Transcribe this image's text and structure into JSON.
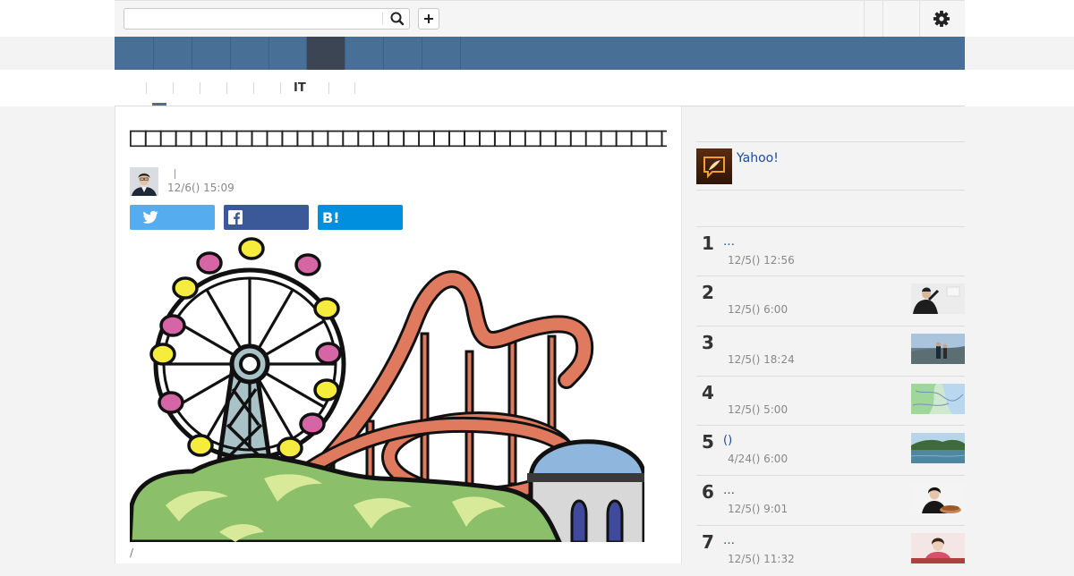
{
  "colors": {
    "nav_bar": "#486f96",
    "nav_active": "#3c4554",
    "link": "#1a4a9b",
    "twitter": "#55acee",
    "facebook": "#3b5998",
    "hatena": "#008fde"
  },
  "search": {
    "value": "",
    "placeholder": ""
  },
  "header": {
    "search_icon": "search-icon",
    "add_icon": "plus-icon",
    "settings_icon": "gear-icon"
  },
  "nav": {
    "item_count": 9,
    "active_index": 5
  },
  "subnav": {
    "active_label": "IT"
  },
  "article": {
    "title": "□□□□□□□□□□□□□□□□□□□□□□□□□□□□□□□□□□□□",
    "published": "12/6() 15:09",
    "byline_separator": "|",
    "share_buttons": [
      "twitter",
      "facebook",
      "hatena-bookmark"
    ],
    "hatena_label": "B!",
    "image_caption": "/"
  },
  "sidebar": {
    "yahoo_label": "Yahoo!",
    "ranking": [
      {
        "rank": "1",
        "title": "…",
        "time": "12/5() 12:56"
      },
      {
        "rank": "2",
        "title": "",
        "time": "12/5() 6:00"
      },
      {
        "rank": "3",
        "title": "",
        "time": "12/5() 18:24"
      },
      {
        "rank": "4",
        "title": "",
        "time": "12/5() 5:00"
      },
      {
        "rank": "5",
        "title": "()",
        "time": "4/24() 6:00"
      },
      {
        "rank": "6",
        "title": "…",
        "time": "12/5() 9:01"
      },
      {
        "rank": "7",
        "title": "…",
        "time": "12/5() 11:32"
      }
    ]
  }
}
